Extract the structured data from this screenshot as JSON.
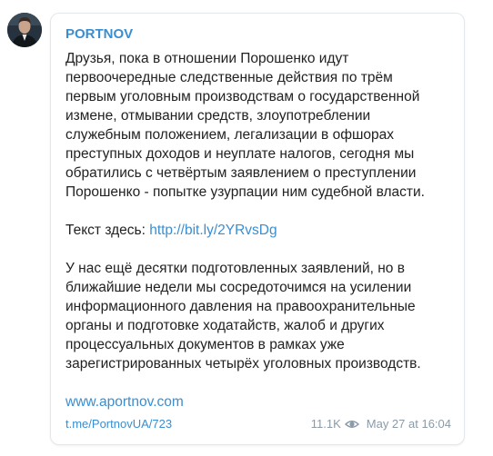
{
  "post": {
    "author": "PORTNOV",
    "paragraphs": [
      {
        "lines": [
          "Друзья, пока в отношении Порошенко идут",
          "первоочередные следственные действия по трём",
          "первым уголовным производствам о государственной",
          "измене, отмывании средств, злоупотреблении",
          "служебным положением, легализации в офшорах",
          "преступных доходов и неуплате налогов, сегодня мы",
          "обратились с четвёртым заявлением о преступлении",
          "Порошенко - попытке узурпации ним судебной власти."
        ]
      },
      {
        "prefix": "Текст здесь: ",
        "link": "http://bit.ly/2YRvsDg"
      },
      {
        "lines": [
          "У нас ещё десятки подготовленных заявлений, но в",
          "ближайшие недели мы сосредоточимся на усилении",
          "информационного давления на правоохранительные",
          "органы и подготовке ходатайств, жалоб и других",
          "процессуальных документов в рамках уже",
          "зарегистрированных четырёх уголовных производств."
        ]
      }
    ],
    "site_link": "www.aportnov.com",
    "footer": {
      "post_link": "t.me/PortnovUA/723",
      "views": "11.1K",
      "views_icon": "eye-icon",
      "date": "May 27 at 16:04"
    }
  },
  "colors": {
    "author": "#3a8ed0",
    "link": "#3a8ed0",
    "text": "#222222",
    "meta": "#8a9aa9",
    "card_border": "#e4e7ea"
  }
}
